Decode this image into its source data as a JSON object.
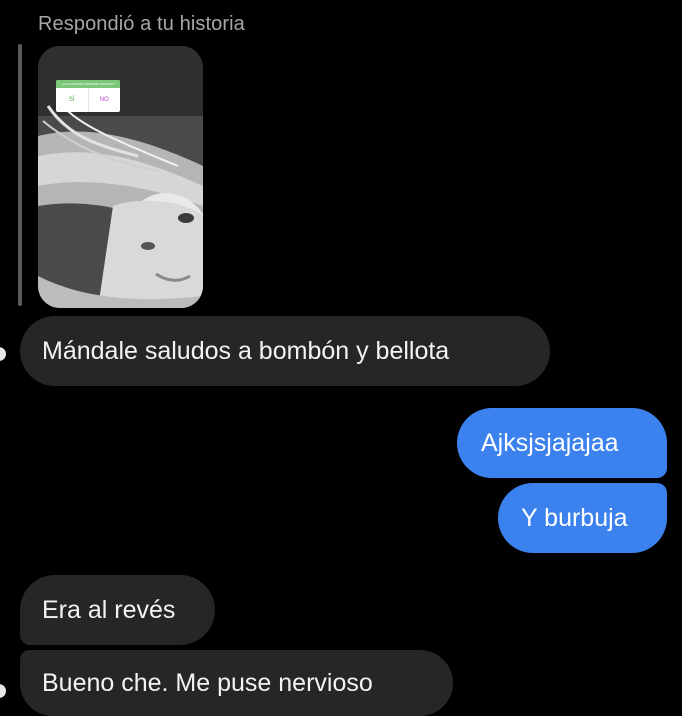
{
  "story_reply": {
    "label": "Respondió a tu historia",
    "poll": {
      "question": "¿LE GUSTARÍA CASARSE CONMIGO?",
      "option_yes": "SÍ",
      "option_no": "NO"
    }
  },
  "messages": [
    {
      "side": "received",
      "text": "Mándale saludos a bombón y bellota"
    },
    {
      "side": "sent",
      "text": "Ajksjsjajajaa"
    },
    {
      "side": "sent",
      "text": "Y burbuja"
    },
    {
      "side": "received",
      "text": "Era al revés"
    },
    {
      "side": "received",
      "text": "Bueno che. Me puse nervioso"
    }
  ],
  "colors": {
    "background": "#000000",
    "received_bubble": "#262626",
    "sent_bubble": "#3c82ef",
    "label_text": "#a6a6a6"
  }
}
